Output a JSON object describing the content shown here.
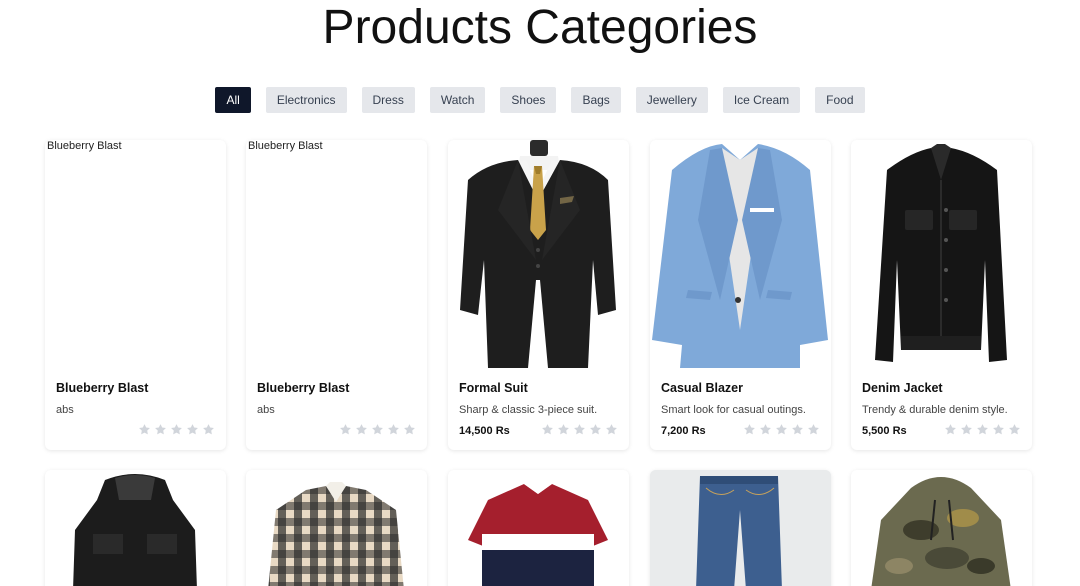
{
  "page": {
    "title": "Products Categories"
  },
  "filters": [
    {
      "label": "All",
      "active": true
    },
    {
      "label": "Electronics",
      "active": false
    },
    {
      "label": "Dress",
      "active": false
    },
    {
      "label": "Watch",
      "active": false
    },
    {
      "label": "Shoes",
      "active": false
    },
    {
      "label": "Bags",
      "active": false
    },
    {
      "label": "Jewellery",
      "active": false
    },
    {
      "label": "Ice Cream",
      "active": false
    },
    {
      "label": "Food",
      "active": false
    }
  ],
  "products": [
    {
      "name": "Blueberry Blast",
      "desc": "abs",
      "price": "",
      "image": "broken",
      "alt": "Blueberry Blast",
      "rating": 0
    },
    {
      "name": "Blueberry Blast",
      "desc": "abs",
      "price": "",
      "image": "broken",
      "alt": "Blueberry Blast",
      "rating": 0
    },
    {
      "name": "Formal Suit",
      "desc": "Sharp & classic 3-piece suit.",
      "price": "14,500 Rs",
      "image": "suit",
      "rating": 0
    },
    {
      "name": "Casual Blazer",
      "desc": "Smart look for casual outings.",
      "price": "7,200 Rs",
      "image": "blazer",
      "rating": 0
    },
    {
      "name": "Denim Jacket",
      "desc": "Trendy & durable denim style.",
      "price": "5,500 Rs",
      "image": "denim-jacket",
      "rating": 0
    }
  ],
  "products_row2": [
    {
      "image": "leather-jacket"
    },
    {
      "image": "plaid-shirt"
    },
    {
      "image": "polo-shirt"
    },
    {
      "image": "jeans"
    },
    {
      "image": "camo-hoodie"
    }
  ],
  "colors": {
    "active_filter": "#0f172a",
    "filter_bg": "#e5e7eb",
    "star_empty": "#d1d5db"
  }
}
